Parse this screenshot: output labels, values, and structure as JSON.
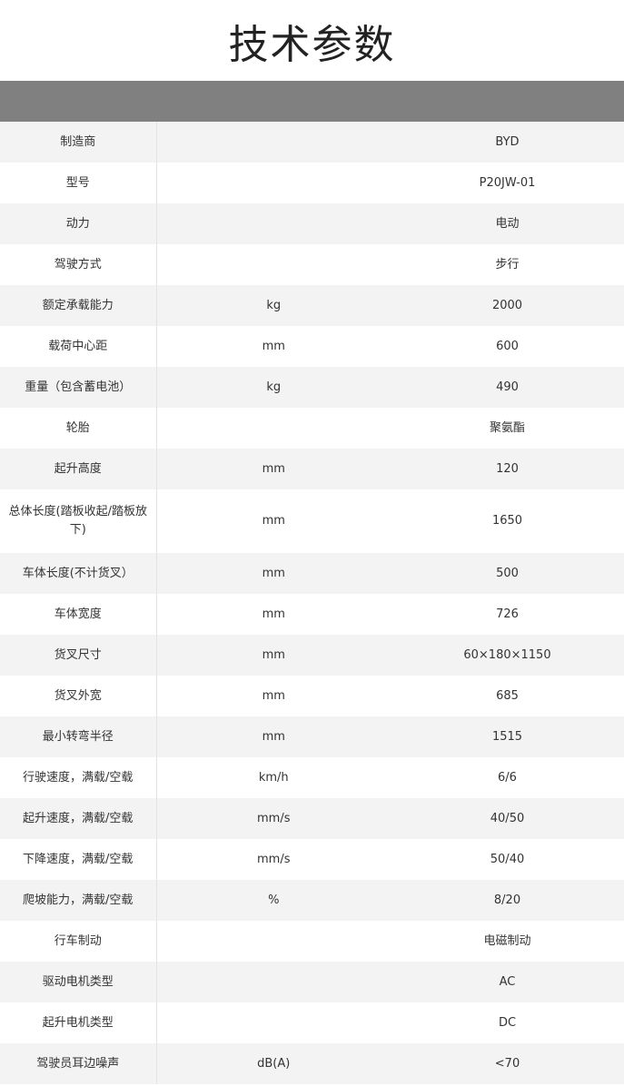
{
  "title": "技术参数",
  "rows": [
    {
      "param": "制造商",
      "unit": "",
      "value": "BYD"
    },
    {
      "param": "型号",
      "unit": "",
      "value": "P20JW-01"
    },
    {
      "param": "动力",
      "unit": "",
      "value": "电动"
    },
    {
      "param": "驾驶方式",
      "unit": "",
      "value": "步行"
    },
    {
      "param": "额定承载能力",
      "unit": "kg",
      "value": "2000"
    },
    {
      "param": "载荷中心距",
      "unit": "mm",
      "value": "600"
    },
    {
      "param": "重量（包含蓄电池）",
      "unit": "kg",
      "value": "490"
    },
    {
      "param": "轮胎",
      "unit": "",
      "value": "聚氨酯"
    },
    {
      "param": "起升高度",
      "unit": "mm",
      "value": "120"
    },
    {
      "param": "总体长度(踏板收起/踏板放下)",
      "unit": "mm",
      "value": "1650"
    },
    {
      "param": "车体长度(不计货叉）",
      "unit": "mm",
      "value": "500"
    },
    {
      "param": "车体宽度",
      "unit": "mm",
      "value": "726"
    },
    {
      "param": "货叉尺寸",
      "unit": "mm",
      "value": "60×180×1150"
    },
    {
      "param": "货叉外宽",
      "unit": "mm",
      "value": "685"
    },
    {
      "param": "最小转弯半径",
      "unit": "mm",
      "value": "1515"
    },
    {
      "param": "行驶速度，满载/空载",
      "unit": "km/h",
      "value": "6/6"
    },
    {
      "param": "起升速度，满载/空载",
      "unit": "mm/s",
      "value": "40/50"
    },
    {
      "param": "下降速度，满载/空载",
      "unit": "mm/s",
      "value": "50/40"
    },
    {
      "param": "爬坡能力，满载/空载",
      "unit": "%",
      "value": "8/20"
    },
    {
      "param": "行车制动",
      "unit": "",
      "value": "电磁制动"
    },
    {
      "param": "驱动电机类型",
      "unit": "",
      "value": "AC"
    },
    {
      "param": "起升电机类型",
      "unit": "",
      "value": "DC"
    },
    {
      "param": "驾驶员耳边噪声",
      "unit": "dB(A)",
      "value": "<70"
    }
  ]
}
